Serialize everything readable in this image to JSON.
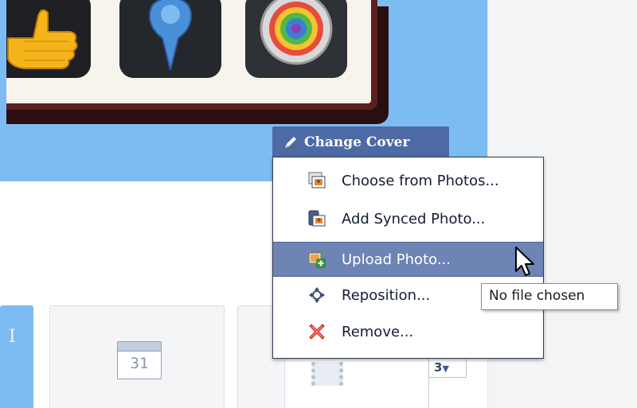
{
  "cover": {
    "app_icons": [
      "thumbs-up-icon",
      "map-pin-icon",
      "camera-lens-icon"
    ]
  },
  "change_cover": {
    "label": "Change Cover",
    "icon": "pencil-icon"
  },
  "menu": {
    "items": [
      {
        "label": "Choose from Photos...",
        "icon": "photo-album-icon"
      },
      {
        "label": "Add Synced Photo...",
        "icon": "synced-photo-icon"
      },
      {
        "label": "Upload Photo...",
        "icon": "upload-photo-icon",
        "highlighted": true
      },
      {
        "label": "Reposition...",
        "icon": "move-arrows-icon"
      },
      {
        "label": "Remove...",
        "icon": "remove-x-icon"
      }
    ]
  },
  "tooltip": {
    "text": "No file chosen"
  },
  "tiles": {
    "calendar_day": "31",
    "count": "3"
  },
  "colors": {
    "cover_blue": "#7cbcf2",
    "button_blue": "#4e6aa5",
    "highlight_blue": "#6d84b4",
    "remove_red": "#d9342b"
  }
}
